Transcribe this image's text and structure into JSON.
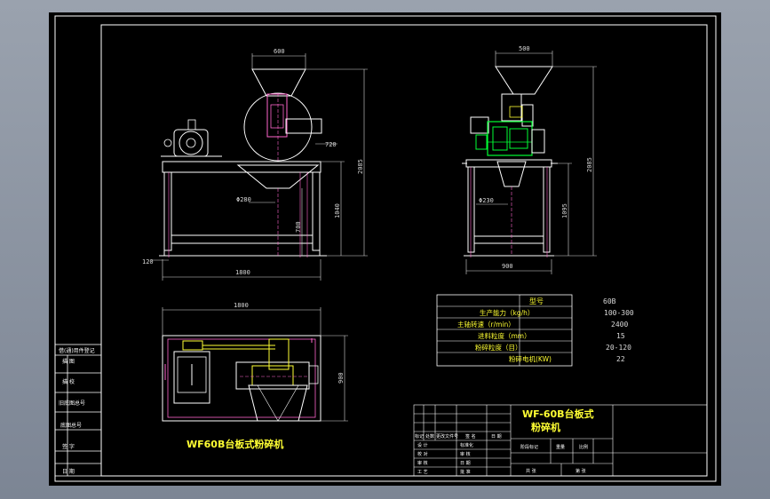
{
  "colors": {
    "background": "#000000",
    "border": "#ffffff",
    "dimension": "#d9d9d9",
    "machine_outline": "#ffffff",
    "hidden": "#ff66cc",
    "green": "#00ff33",
    "yellow": "#ffff33",
    "cyan": "#66ffff",
    "table_border": "#ffffff"
  },
  "front_view": {
    "dim_top_width": "600",
    "dim_side": "720",
    "dim_total_height": "2085",
    "dim_table_height": "1040",
    "dim_leg": "700",
    "dim_hole": "Φ280",
    "dim_foot": "120",
    "dim_total_width": "1800"
  },
  "side_view": {
    "dim_top_width": "500",
    "dim_total_height": "2085",
    "dim_table_height": "1095",
    "dim_hole": "Φ230",
    "dim_width": "900"
  },
  "plan_view": {
    "dim_width": "1800",
    "dim_depth": "900",
    "caption": "WF60B台板式粉碎机"
  },
  "spec_table": {
    "header_label": "型号",
    "header_value": "60B",
    "rows": [
      {
        "label": "生产能力（kg/h）",
        "value": "100-300"
      },
      {
        "label": "主轴转速（r/min）",
        "value": "2400"
      },
      {
        "label": "进料粒度（mm）",
        "value": "15"
      },
      {
        "label": "粉碎粒度（目）",
        "value": "20-120"
      },
      {
        "label": "粉碎电机(KW)",
        "value": "22"
      }
    ]
  },
  "side_block": {
    "cells": [
      "借(通)用件登记",
      "描 图",
      "描 校",
      "旧底图总号",
      "底图总号",
      "签 字",
      "日 期"
    ]
  },
  "title_block": {
    "title_line1": "WF-60B台板式",
    "title_line2": "粉碎机",
    "row_headers": [
      "标记",
      "处数",
      "更改文件号",
      "签 名",
      "日 期"
    ],
    "roles": [
      "设 计",
      "校 对",
      "审 核",
      "工 艺"
    ],
    "role_right": [
      "标准化",
      "审 核",
      "日 期",
      "批 准"
    ],
    "stage_labels": [
      "阶段标记",
      "重量",
      "比例"
    ],
    "sheet_labels": [
      "共  张",
      "第  张"
    ]
  }
}
